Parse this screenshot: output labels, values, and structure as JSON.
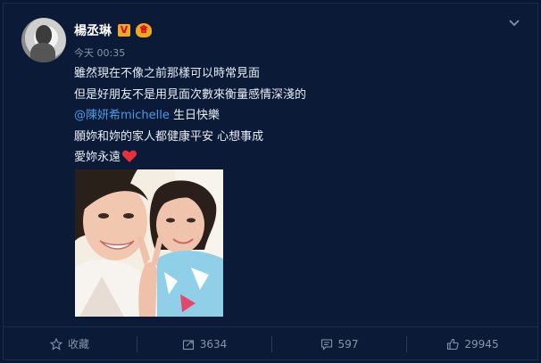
{
  "post": {
    "author": "楊丞琳",
    "verified_badge": "V",
    "vip_badge": "會",
    "timestamp": "今天 00:35",
    "lines": [
      "雖然現在不像之前那樣可以時常見面",
      "但是好朋友不是用見面次數來衡量感情深淺的"
    ],
    "mention": "@陳妍希michelle",
    "mention_suffix": " 生日快樂",
    "line4": "願妳和妳的家人都健康平安 心想事成",
    "line5": "愛妳永遠",
    "heart_icon": "red-heart-emoji",
    "menu_icon": "chevron-down-icon"
  },
  "actions": {
    "favorite_label": "收藏",
    "repost_count": "3634",
    "comment_count": "597",
    "like_count": "29945"
  },
  "colors": {
    "background": "#0b1a36",
    "text": "#e8edf5",
    "muted": "#8a94a8",
    "link": "#4c9be8",
    "heart": "#e8303d"
  }
}
